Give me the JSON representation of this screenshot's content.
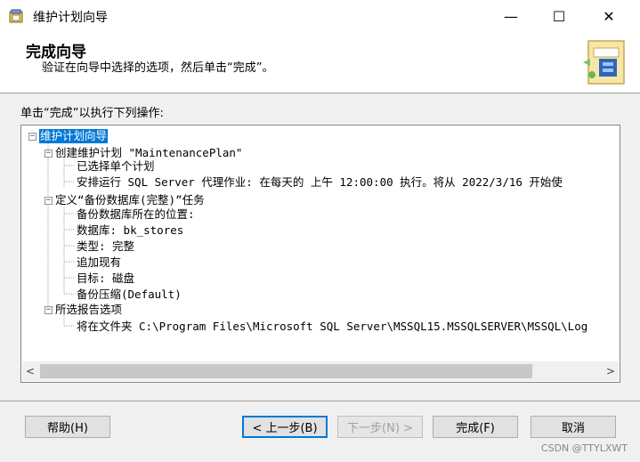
{
  "window": {
    "title": "维护计划向导",
    "minimize_glyph": "—",
    "maximize_glyph": "☐",
    "close_glyph": "✕"
  },
  "header": {
    "title": "完成向导",
    "subtitle": "验证在向导中选择的选项，然后单击“完成”。"
  },
  "instruction": "单击“完成”以执行下列操作:",
  "tree": {
    "root": "维护计划向导",
    "group1": {
      "label": "创建维护计划 \"MaintenancePlan\"",
      "items": [
        "已选择单个计划",
        "安排运行 SQL Server 代理作业: 在每天的 上午 12:00:00 执行。将从 2022/3/16 开始使"
      ]
    },
    "group2": {
      "label": "定义“备份数据库(完整)”任务",
      "items": [
        "备份数据库所在的位置:",
        "数据库: bk_stores",
        "类型: 完整",
        "追加现有",
        "目标: 磁盘",
        "备份压缩(Default)"
      ]
    },
    "group3": {
      "label": "所选报告选项",
      "items": [
        "将在文件夹 C:\\Program Files\\Microsoft SQL Server\\MSSQL15.MSSQLSERVER\\MSSQL\\Log"
      ]
    },
    "toggle_glyph": "−"
  },
  "scrollbar": {
    "left_glyph": "<",
    "right_glyph": ">"
  },
  "buttons": {
    "help": "帮助(H)",
    "back": "< 上一步(B)",
    "next": "下一步(N) >",
    "finish": "完成(F)",
    "cancel": "取消"
  },
  "watermark": "CSDN @TTYLXWT",
  "colors": {
    "selection": "#0078d7",
    "face": "#f0f0f0"
  }
}
